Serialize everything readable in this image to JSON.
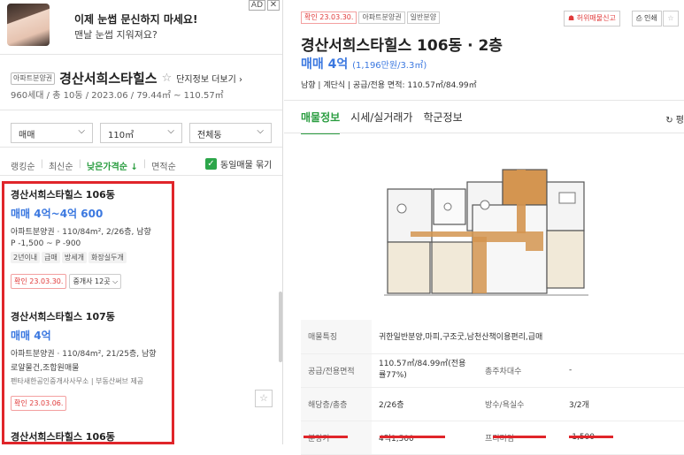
{
  "ad": {
    "title": "이제 눈썹 문신하지 마세요!",
    "subtitle": "맨날 눈썹 지워져요?",
    "badge": "AD",
    "close": "✕"
  },
  "complex": {
    "type_tag": "아파트분양권",
    "name": "경산서희스타힐스",
    "favorite_icon": "☆",
    "detail_link": "단지정보 더보기 ›",
    "info": "960세대 / 총 10동 / 2023.06 / 79.44㎡ ~ 110.57㎡"
  },
  "filters": {
    "trade": "매매",
    "area": "110㎡",
    "dong": "전체동"
  },
  "sorts": {
    "items": [
      "랭킹순",
      "최신순",
      "낮은가격순 ↓",
      "면적순"
    ],
    "same_listing": "동일매물 묶기"
  },
  "listings": [
    {
      "name": "경산서희스타힐스 106동",
      "price": "매매 4억~4억 600",
      "spec": "아파트분양권 · 110/84m², 2/26층, 남향",
      "premium": "P -1,500 ~ P -900",
      "chips": [
        "2년이내",
        "급매",
        "방세개",
        "화장실두개"
      ],
      "confirm": "확인 23.03.30.",
      "agents": "중개사 12곳 ⌵"
    },
    {
      "name": "경산서희스타힐스 107동",
      "price": "매매 4억",
      "spec": "아파트분양권 · 110/84m², 21/25층, 남향",
      "desc": "로얄물건,조합원매물",
      "source": "펜타새한공인중개사사무소 | 부동산써브 제공",
      "confirm": "확인 23.03.06."
    },
    {
      "name": "경산서희스타힐스 106동"
    }
  ],
  "detail": {
    "tags": [
      "확인 23.03.30.",
      "아파트분양권",
      "일반분양"
    ],
    "report_btn": "☗ 허위매물신고",
    "print_btn": "⎙ 인쇄",
    "fav_btn": "☆",
    "title": "경산서희스타힐스 106동 · 2층",
    "price": "매매 4억",
    "price_sub": "(1,196만원/3.3㎡)",
    "spec": "남향 | 계단식 | 공급/전용 면적: 110.57㎡/84.99㎡",
    "tabs": [
      "매물정보",
      "시세/실거래가",
      "학군정보"
    ],
    "refresh": "↻ 평",
    "rows": [
      {
        "k": "매물특징",
        "v": "귀한일반분양,마피,구조굿,남천산책이용편리,급매"
      },
      {
        "k": "공급/전용면적",
        "v": "110.57㎡/84.99㎡(전용률77%)",
        "k2": "총주차대수",
        "v2": "-"
      },
      {
        "k": "해당층/총층",
        "v": "2/26층",
        "k2": "방수/욕실수",
        "v2": "3/2개"
      },
      {
        "k": "분양가",
        "v": "4억1,500",
        "k2": "프리미엄",
        "v2": "-1,500"
      }
    ]
  },
  "colors": {
    "accent_green": "#2a9d40",
    "price_blue": "#3b78e0",
    "highlight_red": "#e0252a"
  }
}
